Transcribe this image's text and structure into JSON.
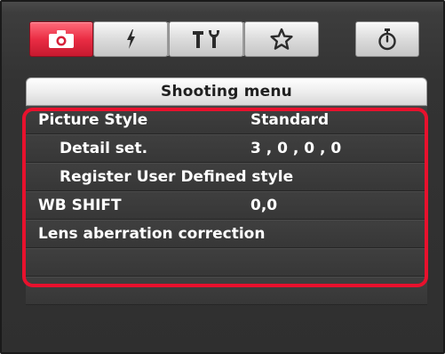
{
  "tabs": [
    {
      "name": "shooting",
      "icon": "camera-icon",
      "active": true
    },
    {
      "name": "flash",
      "icon": "lightning-icon",
      "active": false
    },
    {
      "name": "settings",
      "icon": "tools-icon",
      "active": false
    },
    {
      "name": "my-menu",
      "icon": "star-icon",
      "active": false
    },
    {
      "name": "timer",
      "icon": "stopwatch-icon",
      "active": false
    }
  ],
  "panel": {
    "title": "Shooting menu",
    "rows": [
      {
        "label": "Picture Style",
        "value": "Standard"
      },
      {
        "label": "Detail set.",
        "value": "3 , 0 , 0 , 0"
      },
      {
        "label": "Register User Defined style",
        "value": ""
      },
      {
        "label": "WB SHIFT",
        "value": "0,0"
      },
      {
        "label": "Lens aberration correction",
        "value": ""
      },
      {
        "label": "",
        "value": ""
      },
      {
        "label": "",
        "value": ""
      }
    ]
  },
  "colors": {
    "active_tab": "#e8283f",
    "highlight": "#e8112d",
    "row_text": "#ffffff"
  }
}
